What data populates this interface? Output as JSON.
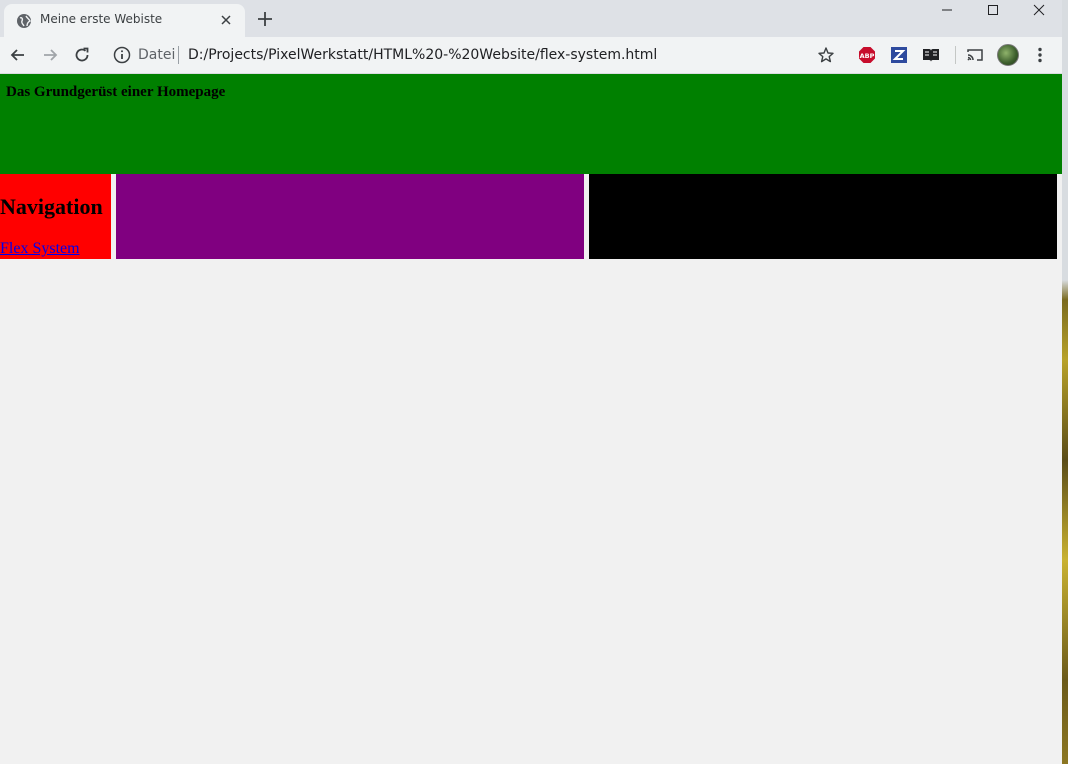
{
  "browser": {
    "tab": {
      "title": "Meine erste Webiste",
      "favicon": "globe-icon"
    },
    "window_controls": [
      "minimize-icon",
      "maximize-icon",
      "close-icon"
    ],
    "toolbar": {
      "site_info_label": "Datei",
      "url": "D:/Projects/PixelWerkstatt/HTML%20-%20Website/flex-system.html",
      "extensions": [
        "adblock-plus-icon",
        "zotero-icon",
        "reader-icon",
        "cast-icon"
      ]
    }
  },
  "page": {
    "header": {
      "title": "Das Grundgerüst einer Homepage",
      "color": "#008000"
    },
    "nav": {
      "heading": "Navigation",
      "link_label": "Flex System",
      "color": "#ff0000"
    },
    "content": {
      "color": "#800080"
    },
    "aside": {
      "color": "#000000"
    }
  }
}
